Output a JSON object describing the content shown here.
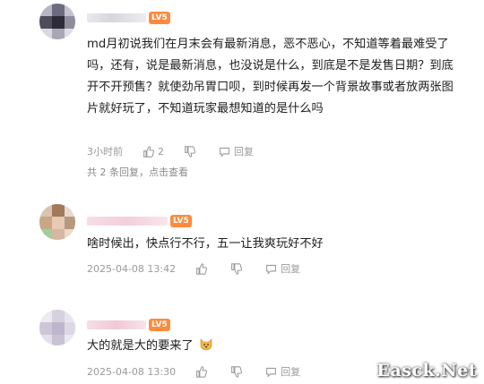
{
  "comments": [
    {
      "level": "LV5",
      "text": "md月初说我们在月末会有最新消息，恶不恶心，不知道等着最难受了吗，还有，说是最新消息，也没说是什么，到底是不是发售日期？到底开不开预售？就使劲吊胃口呗，到时候再发一个背景故事或者放两张图片就好玩了，不知道玩家最想知道的是什么吗",
      "time": "3小时前",
      "likes": "2",
      "reply_label": "回复",
      "replies_summary": "共 2 条回复，点击查看"
    },
    {
      "level": "LV5",
      "text": "啥时候出，快点行不行，五一让我爽玩好不好",
      "time": "2025-04-08 13:42",
      "reply_label": "回复"
    },
    {
      "level": "LV5",
      "text": "大的就是大的要来了",
      "time": "2025-04-08 13:30",
      "reply_label": "回复"
    }
  ],
  "icons": [
    "thumb-up-icon",
    "thumb-down-icon",
    "reply-icon",
    "dog-emoji-icon"
  ],
  "watermark": "Easck.Net",
  "colors": {
    "level_badge": "#ff8a3d",
    "meta_text": "#9a9a9a"
  }
}
